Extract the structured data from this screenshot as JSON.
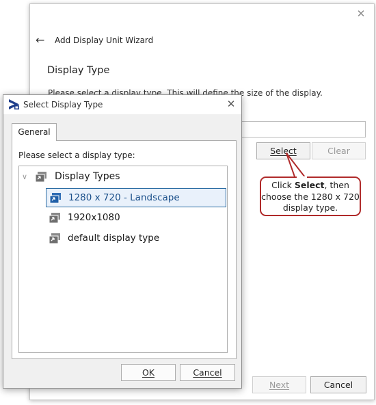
{
  "wizard": {
    "title": "Add Display Unit Wizard",
    "heading": "Display Type",
    "description": "Please select a display type.  This will define the size of the display.",
    "input_value": "",
    "select_label": "Select",
    "clear_label": "Clear",
    "next_label": "Next",
    "cancel_label": "Cancel"
  },
  "callout": {
    "prefix": "Click ",
    "bold": "Select",
    "suffix": ", then choose the 1280 x 720 display type.",
    "border_color": "#b02a2a"
  },
  "dialog": {
    "title": "Select Display Type",
    "tab": "General",
    "prompt": "Please select a display type:",
    "tree": {
      "root": "Display Types",
      "items": [
        {
          "label": "1280 x 720 - Landscape",
          "selected": true
        },
        {
          "label": "1920x1080",
          "selected": false
        },
        {
          "label": "default display type",
          "selected": false
        }
      ]
    },
    "ok_label": "OK",
    "cancel_label": "Cancel"
  },
  "icons": {
    "close": "close-icon",
    "back": "back-arrow-icon",
    "expand": "chevron-down-icon",
    "display": "display-type-icon",
    "app": "app-logo-icon"
  },
  "colors": {
    "selection_border": "#2b6ca3",
    "selection_fill": "#e9f1fb",
    "disabled_text": "#9a9a9a"
  }
}
